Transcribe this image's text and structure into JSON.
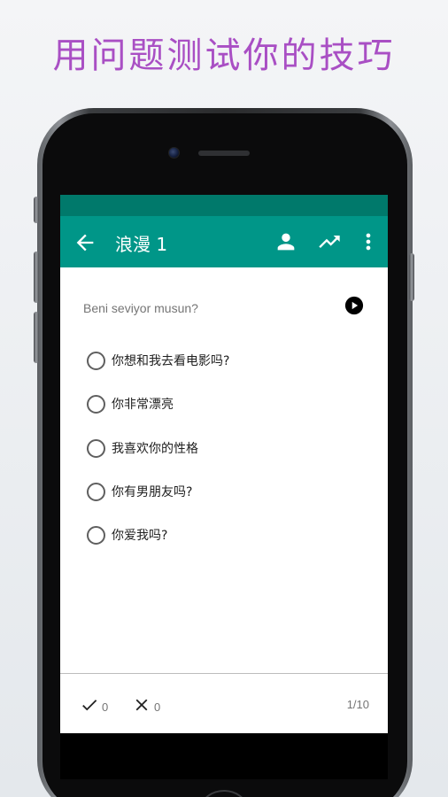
{
  "promo": {
    "headline": "用问题测试你的技巧"
  },
  "app_bar": {
    "title": "浪漫 1",
    "back_icon": "arrow-back-icon",
    "actions": [
      "person-icon",
      "trending-up-icon",
      "more-vert-icon"
    ]
  },
  "quiz": {
    "question": "Beni seviyor musun?",
    "play_icon": "play-circle-icon",
    "options": [
      {
        "label": "你想和我去看电影吗?",
        "selected": false
      },
      {
        "label": "你非常漂亮",
        "selected": false
      },
      {
        "label": "我喜欢你的性格",
        "selected": false
      },
      {
        "label": "你有男朋友吗?",
        "selected": false
      },
      {
        "label": "你爱我吗?",
        "selected": false
      }
    ]
  },
  "footer": {
    "correct_count": "0",
    "wrong_count": "0",
    "progress": "1/10"
  },
  "colors": {
    "headline": "#a94fc4",
    "status_bar": "#00796b",
    "app_bar": "#009688"
  }
}
